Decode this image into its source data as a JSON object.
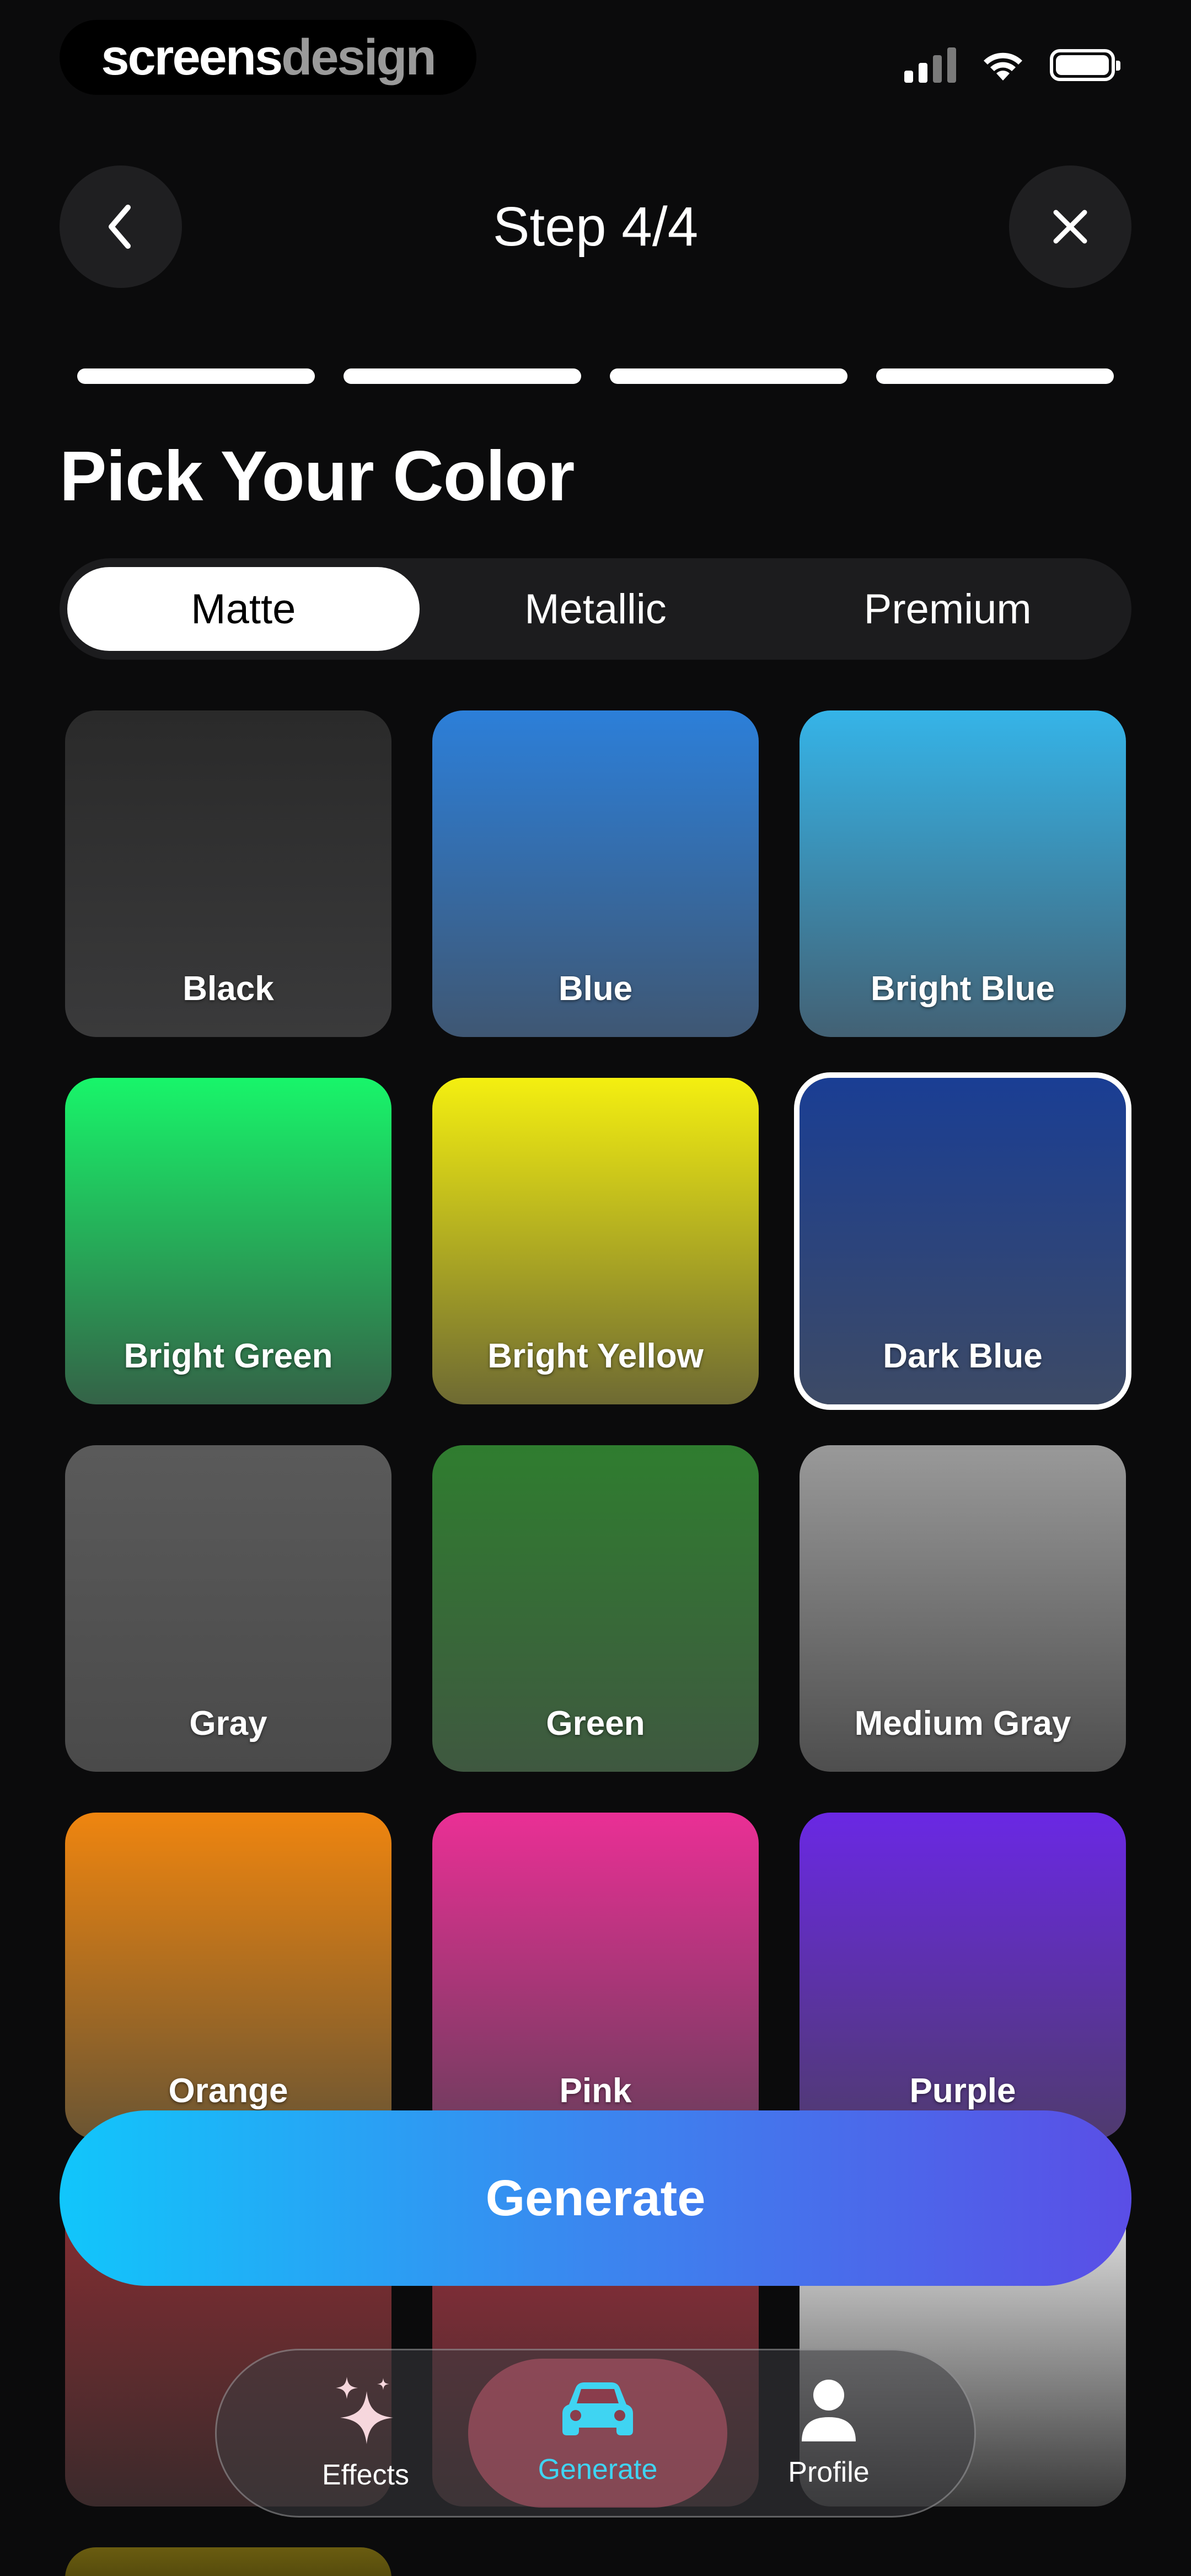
{
  "status_bar": {
    "brand_part1": "screens",
    "brand_part2": "design"
  },
  "header": {
    "title": "Step 4/4",
    "progress_steps_total": 4,
    "progress_steps_done": 4
  },
  "heading": "Pick Your Color",
  "finish_tabs": [
    {
      "label": "Matte",
      "active": true
    },
    {
      "label": "Metallic",
      "active": false
    },
    {
      "label": "Premium",
      "active": false
    }
  ],
  "colors": [
    {
      "label": "Black",
      "top": "#2a2a2a",
      "bottom": "#3a3a3b"
    },
    {
      "label": "Blue",
      "top": "#2c7fd9",
      "bottom": "#3f5773"
    },
    {
      "label": "Bright Blue",
      "top": "#35b4e8",
      "bottom": "#436174"
    },
    {
      "label": "Bright Green",
      "top": "#18f56a",
      "bottom": "#346247"
    },
    {
      "label": "Bright Yellow",
      "top": "#f4ef10",
      "bottom": "#6e6a33"
    },
    {
      "label": "Dark Blue",
      "top": "#1a3e94",
      "bottom": "#3d4a65",
      "selected": true
    },
    {
      "label": "Gray",
      "top": "#5a5a5a",
      "bottom": "#4a4a4a"
    },
    {
      "label": "Green",
      "top": "#2f7d2f",
      "bottom": "#3f5840"
    },
    {
      "label": "Medium Gray",
      "top": "#999999",
      "bottom": "#4e4e4e"
    },
    {
      "label": "Orange",
      "top": "#ef850f",
      "bottom": "#6a5533"
    },
    {
      "label": "Pink",
      "top": "#ea2f95",
      "bottom": "#6b3d5c"
    },
    {
      "label": "Purple",
      "top": "#6a28e4",
      "bottom": "#4f3b6e"
    },
    {
      "label": "",
      "top": "#8c2e33",
      "bottom": "#3a2a2b"
    },
    {
      "label": "",
      "top": "#9a2f3b",
      "bottom": "#3e2a2d"
    },
    {
      "label": "",
      "top": "#f4f4f4",
      "bottom": "#3a3a3a"
    }
  ],
  "generate_label": "Generate",
  "tab_bar": [
    {
      "label": "Effects",
      "icon": "sparkles-icon",
      "active": false
    },
    {
      "label": "Generate",
      "icon": "car-icon",
      "active": true
    },
    {
      "label": "Profile",
      "icon": "person-icon",
      "active": false
    }
  ]
}
